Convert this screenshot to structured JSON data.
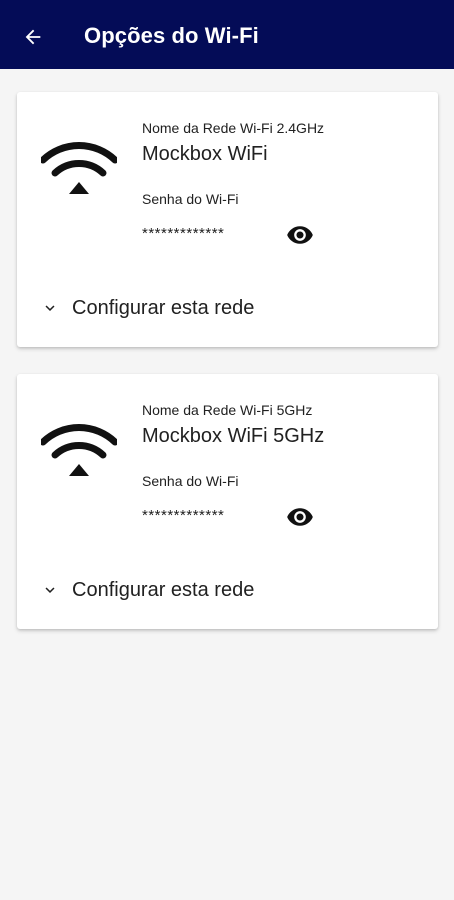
{
  "appbar": {
    "title": "Opções do Wi-Fi",
    "back_icon": "arrow-left-icon",
    "color": "#040c57"
  },
  "networks": [
    {
      "label": "Nome da Rede Wi-Fi 2.4GHz",
      "name": "Mockbox WiFi",
      "password_label": "Senha do Wi-Fi",
      "password_masked": "*************",
      "configure_label": "Configurar esta rede"
    },
    {
      "label": "Nome da Rede Wi-Fi 5GHz",
      "name": "Mockbox WiFi 5GHz",
      "password_label": "Senha do Wi-Fi",
      "password_masked": "*************",
      "configure_label": "Configurar esta rede"
    }
  ],
  "icons": {
    "wifi": "wifi-icon",
    "eye": "eye-icon",
    "chevron": "chevron-down-icon"
  }
}
